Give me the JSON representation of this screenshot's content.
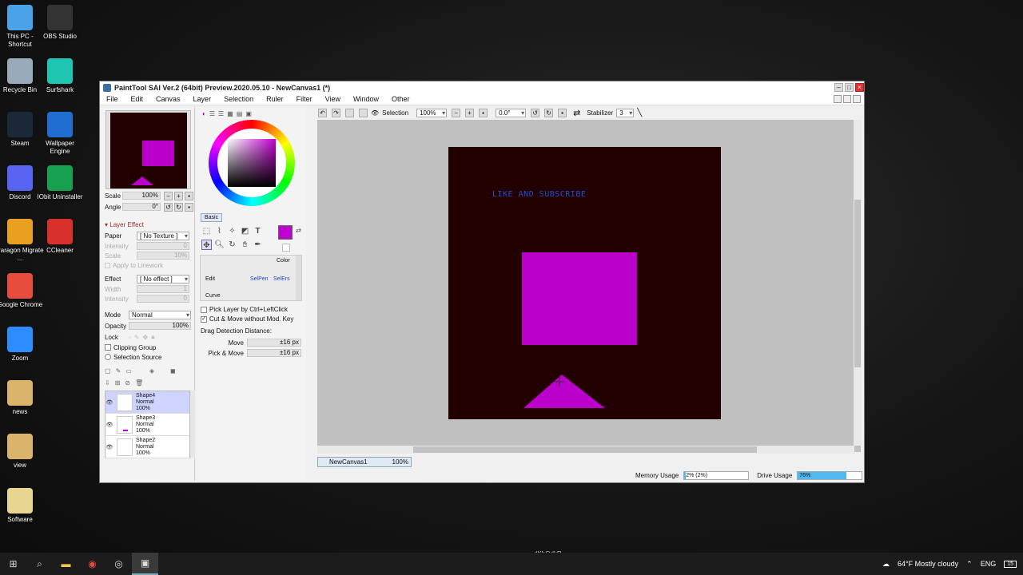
{
  "desktop": {
    "icons": [
      {
        "label": "This PC - Shortcut",
        "icon": "computer-icon",
        "color": "#4aa3e8"
      },
      {
        "label": "OBS Studio",
        "icon": "obs-icon",
        "color": "#333333"
      },
      {
        "label": "Recycle Bin",
        "icon": "recycle-bin-icon",
        "color": "#9ab"
      },
      {
        "label": "Surfshark",
        "icon": "surfshark-icon",
        "color": "#1ec5b0"
      },
      {
        "label": "Steam",
        "icon": "steam-icon",
        "color": "#1b2838"
      },
      {
        "label": "Wallpaper Engine",
        "icon": "wallpaper-engine-icon",
        "color": "#1f6fd0"
      },
      {
        "label": "Discord",
        "icon": "discord-icon",
        "color": "#5865f2"
      },
      {
        "label": "IObit Uninstaller",
        "icon": "iobit-icon",
        "color": "#17a050"
      },
      {
        "label": "Paragon Migrate ...",
        "icon": "paragon-icon",
        "color": "#e9a020"
      },
      {
        "label": "CCleaner",
        "icon": "ccleaner-icon",
        "color": "#d8302a"
      },
      {
        "label": "Google Chrome",
        "icon": "chrome-icon",
        "color": "#e74c3c"
      },
      {
        "label": "Zoom",
        "icon": "zoom-icon",
        "color": "#2d8cff"
      },
      {
        "label": "news",
        "icon": "file-icon",
        "color": "#d9b46a"
      },
      {
        "label": "view",
        "icon": "file-icon",
        "color": "#d9b46a"
      },
      {
        "label": "Software",
        "icon": "file-icon",
        "color": "#e8d690"
      }
    ],
    "center_label": "dKbOdkR"
  },
  "window": {
    "title": "PaintTool SAI Ver.2 (64bit) Preview.2020.05.10 - NewCanvas1 (*)",
    "menu": [
      "File",
      "Edit",
      "Canvas",
      "Layer",
      "Selection",
      "Ruler",
      "Filter",
      "View",
      "Window",
      "Other"
    ]
  },
  "navigator": {
    "scale_label": "Scale",
    "scale_value": "100%",
    "angle_label": "Angle",
    "angle_value": "0°"
  },
  "layer_effect": {
    "header": "Layer Effect",
    "paper_label": "Paper",
    "paper_value": "[ No Texture ]",
    "intensity_label": "Intensity",
    "intensity_value": "0",
    "scale_label": "Scale",
    "scale_value": "10%",
    "apply_linework": "Apply to Linework",
    "effect_label": "Effect",
    "effect_value": "[ No effect ]",
    "width_label": "Width",
    "width_value": "1",
    "effect_intensity_label": "Intensity",
    "effect_intensity_value": "0"
  },
  "layer_props": {
    "mode_label": "Mode",
    "mode_value": "Normal",
    "opacity_label": "Opacity",
    "opacity_value": "100%",
    "lock_label": "Lock",
    "clipping_group": "Clipping Group",
    "selection_source": "Selection Source"
  },
  "layers": [
    {
      "name": "Shape4",
      "mode": "Normal",
      "opacity": "100%"
    },
    {
      "name": "Shape3",
      "mode": "Normal",
      "opacity": "100%"
    },
    {
      "name": "Shape2",
      "mode": "Normal",
      "opacity": "100%"
    }
  ],
  "color_panel": {
    "basic_tab": "Basic",
    "current_color": "#c000d0",
    "tool_groups": [
      "Color",
      "Edit",
      "SelPen",
      "SelErs",
      "Curve"
    ],
    "pick_layer": "Pick Layer by Ctrl+LeftClick",
    "cut_move": "Cut & Move without Mod. Key",
    "drag_detect": "Drag Detection Distance:",
    "move_label": "Move",
    "move_value": "±16 px",
    "pick_move_label": "Pick & Move",
    "pick_move_value": "±16 px"
  },
  "toolbar": {
    "selection_label": "Selection",
    "zoom_value": "100%",
    "angle_value": "0.0°",
    "stabilizer_label": "Stabilizer",
    "stabilizer_value": "3"
  },
  "canvas": {
    "text": "LIKE AND SUBSCRIBE",
    "background": "#220000",
    "shape_color": "#bb00cc"
  },
  "tabs": [
    {
      "name": "NewCanvas1",
      "zoom": "100%"
    }
  ],
  "status": {
    "memory_label": "Memory Usage",
    "memory_value": "2% (2%)",
    "memory_fraction": 0.02,
    "drive_label": "Drive Usage",
    "drive_value": "76%",
    "drive_fraction": 0.76
  },
  "taskbar": {
    "weather": "64°F  Mostly cloudy",
    "language": "ENG",
    "notifications": "15"
  }
}
